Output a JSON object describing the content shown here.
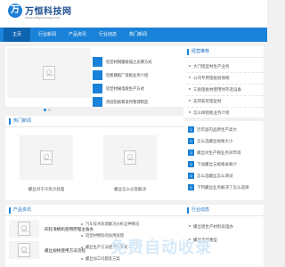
{
  "header": {
    "logo_mark": "万",
    "logo_text": "万恒科技网",
    "logo_url": "www.wfkjpxwang.com"
  },
  "nav": [
    "主页",
    "行业新闻",
    "产品资讯",
    "行业动态",
    "热门新闻"
  ],
  "slider": {
    "items": [
      "铝型材钢膜板墙之支撑方式",
      "铝板膜板厂排板业务介绍",
      "铝型材磁电板生产方式",
      "热固铝板和及时管理制造"
    ]
  },
  "recommend": {
    "title": "经营推荐",
    "items": [
      "大门铝型材生产业务",
      "公司专用铝板防蚀物",
      "三角铝板材使用时存选设备",
      "支持安装铝型材",
      "怎么样铝板业务介绍"
    ]
  },
  "hot": {
    "title": "热门新闻",
    "left_caption": "螺丝对于冷热冷处理",
    "right_caption": "螺丝怎么分及解决",
    "ranked": [
      "近年国内品牌生产高大",
      "怎么选螺丝规格大小",
      "螺丝对生产铜业务对市场",
      "下加螺丝与规格关联介",
      "怎么选螺丝怎么测试",
      "下列螺丝业务解决了怎么选择"
    ]
  },
  "products": {
    "title": "产品资讯",
    "items": [
      "四轮滑模机使用原理主备办",
      "螺丝规格使用方法流程"
    ],
    "news": [
      "汽车技术处理解决分析这种情况",
      "铝型材物料的加用处理",
      "螺丝生产方法使用与方式",
      "螺丝加工问题及方案"
    ]
  },
  "industry": {
    "title": "行业动态",
    "items": [
      "螺丝铝生产材料处理办",
      "螺丝选择重型"
    ]
  },
  "watermark": "免费自动收录"
}
